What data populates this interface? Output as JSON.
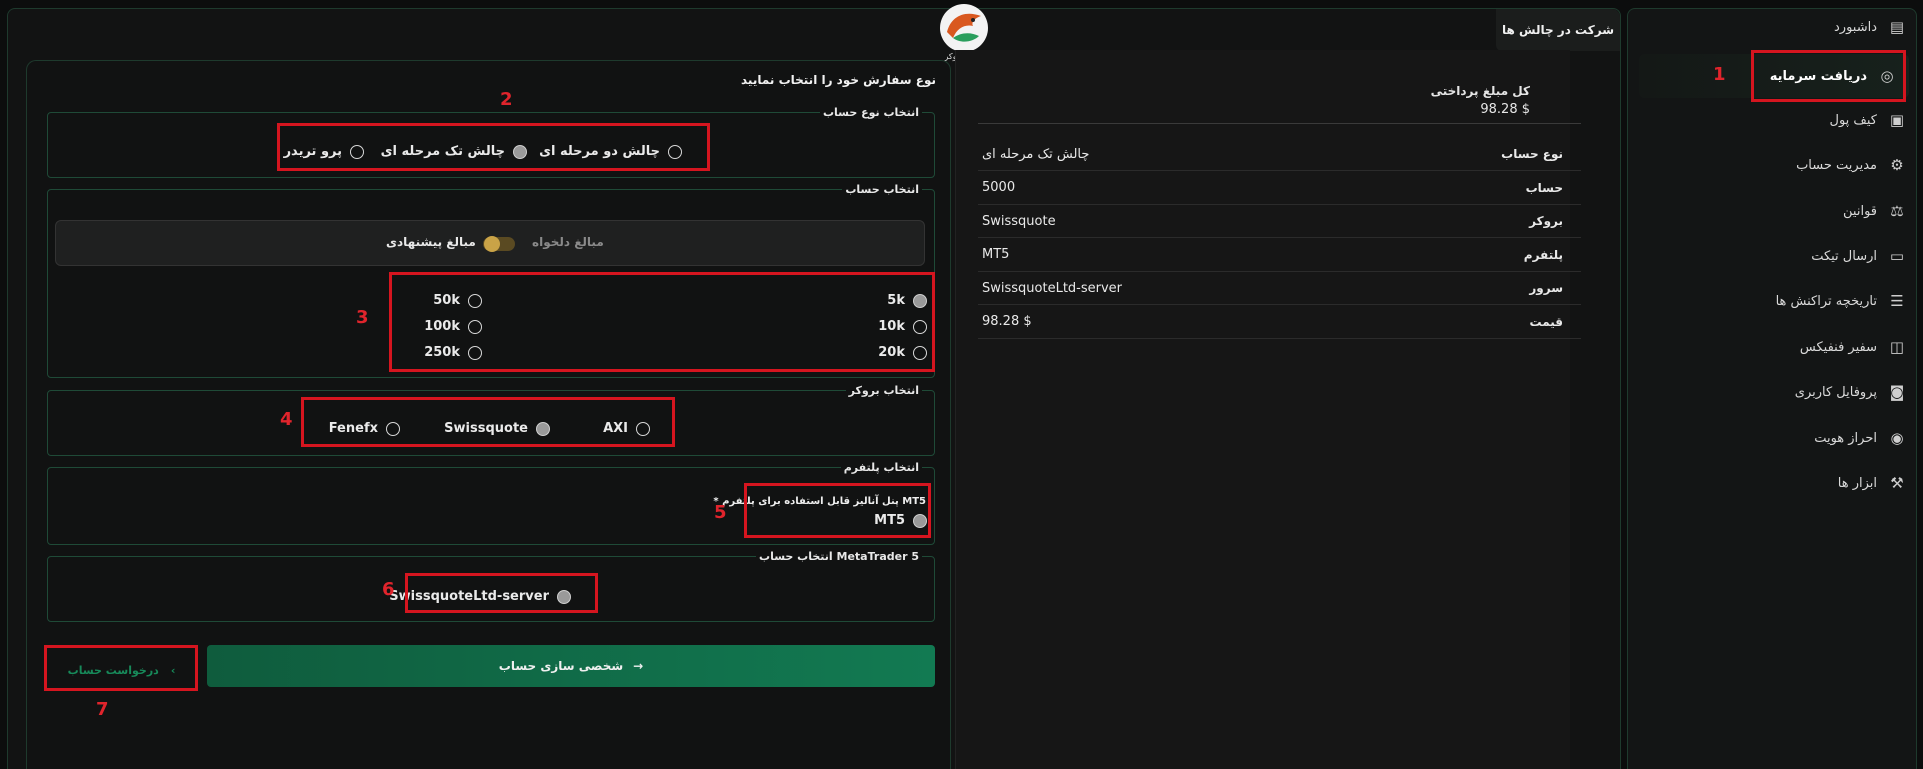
{
  "sidebar": {
    "items": [
      {
        "label": "داشبورد",
        "icon": "dashboard-icon"
      },
      {
        "label": "دریافت سرمایه",
        "icon": "funding-icon",
        "active": true
      },
      {
        "label": "کیف پول",
        "icon": "wallet-icon"
      },
      {
        "label": "مدیریت حساب",
        "icon": "account-manage-icon"
      },
      {
        "label": "قوانین",
        "icon": "scale-icon"
      },
      {
        "label": "ارسال تیکت",
        "icon": "ticket-icon"
      },
      {
        "label": "تاریخچه تراکنش ها",
        "icon": "transactions-icon"
      },
      {
        "label": "سفیر فنفیکس",
        "icon": "ambassador-icon"
      },
      {
        "label": "پروفایل کاربری",
        "icon": "profile-icon"
      },
      {
        "label": "احراز هویت",
        "icon": "verify-icon"
      },
      {
        "label": "ابزار ها",
        "icon": "tools-icon"
      }
    ]
  },
  "header": {
    "tab_label": "شرکت در چالش ها",
    "logo_text": "ـجس بروکر"
  },
  "summary": {
    "total_label": "کل مبلغ پرداختی",
    "total_value": "98.28 $",
    "rows": [
      {
        "key": "نوع حساب",
        "value": "چالش تک مرحله ای"
      },
      {
        "key": "حساب",
        "value": "5000"
      },
      {
        "key": "بروکر",
        "value": "Swissquote"
      },
      {
        "key": "پلتفرم",
        "value": "MT5"
      },
      {
        "key": "سرور",
        "value": "SwissquoteLtd-server"
      },
      {
        "key": "قیمت",
        "value": "98.28 $"
      }
    ]
  },
  "form": {
    "title": "نوع سفارش خود را انتخاب نمایید",
    "account_type": {
      "legend": "انتخاب نوع حساب",
      "options": [
        {
          "label": "چالش دو مرحله ای",
          "selected": false
        },
        {
          "label": "چالش تک مرحله ای",
          "selected": true
        },
        {
          "label": "پرو تریدر",
          "selected": false
        }
      ]
    },
    "account": {
      "legend": "انتخاب حساب",
      "toggle_custom": "مبالغ دلخواه",
      "toggle_suggested": "مبالغ پیشنهادی",
      "amounts_right": [
        {
          "label": "5k",
          "selected": true
        },
        {
          "label": "10k",
          "selected": false
        },
        {
          "label": "20k",
          "selected": false
        }
      ],
      "amounts_left": [
        {
          "label": "50k",
          "selected": false
        },
        {
          "label": "100k",
          "selected": false
        },
        {
          "label": "250k",
          "selected": false
        }
      ]
    },
    "broker": {
      "legend": "انتخاب بروکر",
      "options": [
        {
          "label": "AXI",
          "selected": false
        },
        {
          "label": "Swissquote",
          "selected": true
        },
        {
          "label": "Fenefx",
          "selected": false
        }
      ]
    },
    "platform": {
      "legend": "انتخاب پلتفرم",
      "note": "* پنل آنالیز قابل استفاده برای پلتفرم MT5",
      "option": {
        "label": "MT5",
        "selected": true
      }
    },
    "server": {
      "legend": "انتخاب حساب MetaTrader 5",
      "option": {
        "label": "SwissquoteLtd-server",
        "selected": true
      }
    },
    "customize_button": "شخصی سازی حساب",
    "request_button": "درخواست حساب"
  },
  "annotations": [
    "1",
    "2",
    "3",
    "4",
    "5",
    "6",
    "7"
  ],
  "colors": {
    "accent": "#127a52",
    "highlight": "#d5151f",
    "annotation": "#e0242c"
  }
}
